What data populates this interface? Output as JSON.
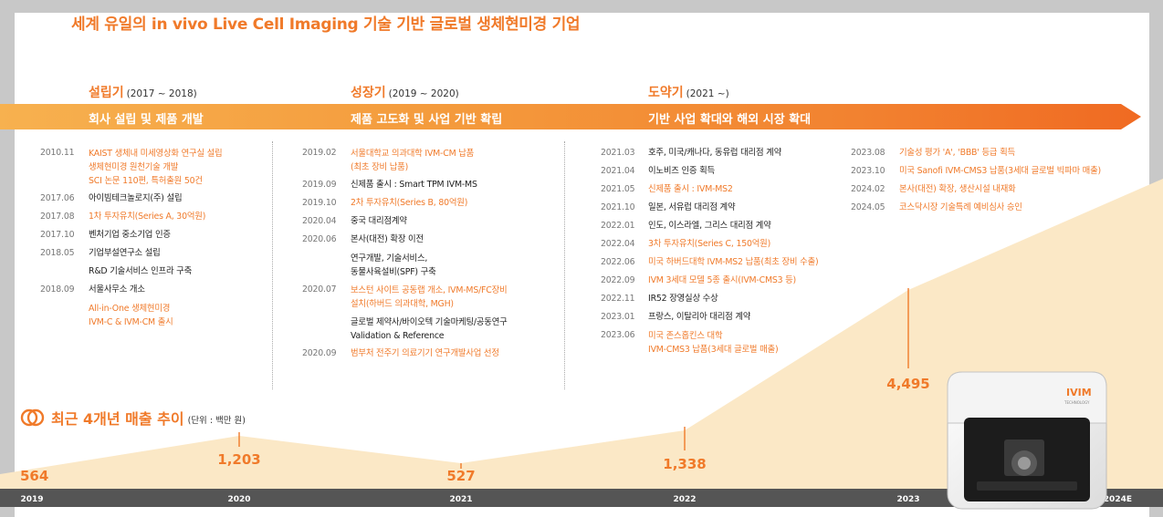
{
  "headline": "세계 유일의 in vivo Live Cell Imaging 기술 기반 글로벌 생체현미경 기업",
  "colors": {
    "accent": "#f07a2a",
    "band_start": "#f7b14f",
    "band_end": "#f06a22",
    "area_fill": "#fbe8c6",
    "axis_bar": "#555555"
  },
  "phases": [
    {
      "title": "설립기",
      "range": "(2017 ~ 2018)",
      "band": "회사 설립 및 제품 개발"
    },
    {
      "title": "성장기",
      "range": "(2019 ~ 2020)",
      "band": "제품 고도화 및 사업 기반 확립"
    },
    {
      "title": "도약기",
      "range": "(2021 ~)",
      "band": "기반 사업 확대와 해외 시장 확대"
    }
  ],
  "timeline": {
    "col1": [
      {
        "date": "2010.11",
        "lines": [
          "KAIST 생체내 미세영상화 연구실 설립",
          "생체현미경 원천기술 개발",
          "SCI 논문 110편, 특허출원 50건"
        ],
        "highlight": true
      },
      {
        "date": "2017.06",
        "lines": [
          "아이빔테크놀로지(주) 설립"
        ],
        "highlight": false
      },
      {
        "date": "2017.08",
        "lines": [
          "1차 투자유치(Series A, 30억원)"
        ],
        "highlight": true
      },
      {
        "date": "2017.10",
        "lines": [
          "벤처기업 중소기업 인증"
        ],
        "highlight": false
      },
      {
        "date": "2018.05",
        "lines": [
          "기업부설연구소 설립"
        ],
        "highlight": false
      },
      {
        "date": "",
        "lines": [
          "R&D 기술서비스 인프라 구축"
        ],
        "highlight": false
      },
      {
        "date": "2018.09",
        "lines": [
          "서울사무소 개소"
        ],
        "highlight": false
      },
      {
        "date": "",
        "lines": [
          "All-in-One 생체현미경",
          "IVM-C & IVM-CM 출시"
        ],
        "highlight": true
      }
    ],
    "col2": [
      {
        "date": "2019.02",
        "lines": [
          "서울대학교 의과대학 IVM-CM 납품",
          "(최초 장비 납품)"
        ],
        "highlight": true
      },
      {
        "date": "2019.09",
        "lines": [
          "신제품 출시 : Smart TPM IVM-MS"
        ],
        "highlight": false
      },
      {
        "date": "2019.10",
        "lines": [
          "2차 투자유치(Series B, 80억원)"
        ],
        "highlight": true
      },
      {
        "date": "2020.04",
        "lines": [
          "중국 대리점계약"
        ],
        "highlight": false
      },
      {
        "date": "2020.06",
        "lines": [
          "본사(대전) 확장 이전"
        ],
        "highlight": false
      },
      {
        "date": "",
        "lines": [
          "연구개발, 기술서비스,",
          "동물사육설비(SPF) 구축"
        ],
        "highlight": false
      },
      {
        "date": "2020.07",
        "lines": [
          "보스턴 사이트 공동랩 개소, IVM-MS/FC장비",
          "설치(하버드 의과대학, MGH)"
        ],
        "highlight": true
      },
      {
        "date": "",
        "lines": [
          "글로벌 제약사/바이오텍 기술마케팅/공동연구",
          "Validation & Reference"
        ],
        "highlight": false
      },
      {
        "date": "2020.09",
        "lines": [
          "범부처 전주기 의료기기 연구개발사업 선정"
        ],
        "highlight": true
      }
    ],
    "col3": [
      {
        "date": "2021.03",
        "lines": [
          "호주, 미국/캐나다, 동유럽 대리점 계약"
        ],
        "highlight": false
      },
      {
        "date": "2021.04",
        "lines": [
          "이노비즈 인증 획득"
        ],
        "highlight": false
      },
      {
        "date": "2021.05",
        "lines": [
          "신제품 출시 : IVM-MS2"
        ],
        "highlight": true
      },
      {
        "date": "2021.10",
        "lines": [
          "일본, 서유럽 대리점 계약"
        ],
        "highlight": false
      },
      {
        "date": "2022.01",
        "lines": [
          "인도, 이스라엘, 그리스 대리점 계약"
        ],
        "highlight": false
      },
      {
        "date": "2022.04",
        "lines": [
          "3차 투자유치(Series C, 150억원)"
        ],
        "highlight": true
      },
      {
        "date": "2022.06",
        "lines": [
          "미국 하버드대학 IVM-MS2 납품(최초 장비 수출)"
        ],
        "highlight": true
      },
      {
        "date": "2022.09",
        "lines": [
          "IVM 3세대 모델 5종 출시(IVM-CMS3 등)"
        ],
        "highlight": true
      },
      {
        "date": "2022.11",
        "lines": [
          "IR52 장영실상 수상"
        ],
        "highlight": false
      },
      {
        "date": "2023.01",
        "lines": [
          "프랑스, 이탈리아 대리점 계약"
        ],
        "highlight": false
      },
      {
        "date": "2023.06",
        "lines": [
          "미국 존스홉킨스 대학",
          "IVM-CMS3 납품(3세대 글로벌 매출)"
        ],
        "highlight": true
      }
    ],
    "col4": [
      {
        "date": "2023.08",
        "lines": [
          "기술성 평가 'A', 'BBB' 등급 획득"
        ],
        "highlight": true
      },
      {
        "date": "2023.10",
        "lines": [
          "미국 Sanofi IVM-CMS3 납품(3세대 글로벌 빅파마 매출)"
        ],
        "highlight": true
      },
      {
        "date": "2024.02",
        "lines": [
          "본사(대전) 확장, 생산시설 내재화"
        ],
        "highlight": true
      },
      {
        "date": "2024.05",
        "lines": [
          "코스닥시장 기술특례 예비심사 승인"
        ],
        "highlight": true
      }
    ]
  },
  "sales": {
    "title": "최근 4개년 매출 추이",
    "unit": "(단위 : 백만 원)"
  },
  "chart_data": {
    "type": "area",
    "x": [
      "2019",
      "2020",
      "2021",
      "2022",
      "2023",
      "2024E"
    ],
    "labels": [
      "564",
      "1,203",
      "527",
      "1,338",
      "4,495"
    ],
    "values": [
      564,
      1203,
      527,
      1338,
      4495,
      null
    ]
  },
  "device": {
    "logo": "IVIM",
    "sub": "TECHNOLOGY",
    "icon": "ivm-microscope-device"
  }
}
